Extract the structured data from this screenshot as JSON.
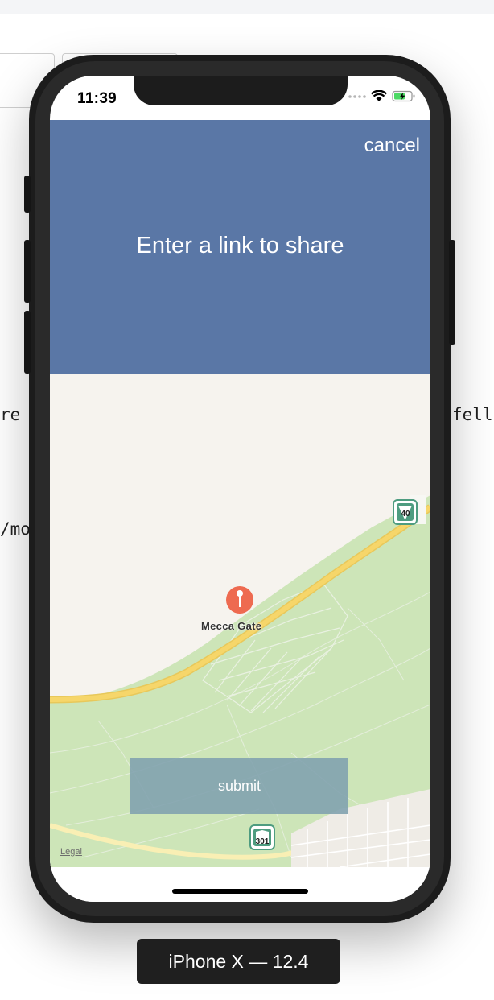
{
  "background_code": {
    "left_line1": "re",
    "left_line2": "/mo",
    "right_line1": "fell"
  },
  "status_bar": {
    "time": "11:39",
    "icons": [
      "signal-dots-icon",
      "wifi-icon",
      "battery-charging-icon"
    ]
  },
  "header": {
    "cancel_label": "cancel",
    "prompt": "Enter a link to share",
    "background_color": "#5a77a6"
  },
  "map": {
    "pin_label": "Mecca Gate",
    "route_shields": [
      "40",
      "301"
    ],
    "legal_label": "Legal",
    "pin_color": "#ee6a50",
    "land_color": "#f6f3ee",
    "park_color": "#cde5b8",
    "road_color": "#f6d66a"
  },
  "submit": {
    "label": "submit"
  },
  "simulator": {
    "device_label": "iPhone X — 12.4"
  }
}
